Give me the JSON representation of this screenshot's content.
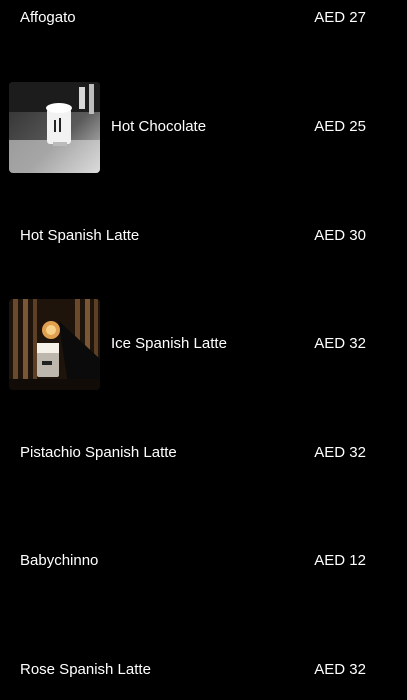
{
  "menu": {
    "currency": "AED",
    "items": [
      {
        "name": "Affogato",
        "price": "AED 27",
        "has_image": false
      },
      {
        "name": "Hot Chocolate",
        "price": "AED 25",
        "has_image": true,
        "image": "hot-chocolate-photo"
      },
      {
        "name": "Hot Spanish Latte",
        "price": "AED 30",
        "has_image": false
      },
      {
        "name": "Ice Spanish Latte",
        "price": "AED 32",
        "has_image": true,
        "image": "ice-spanish-latte-photo"
      },
      {
        "name": "Pistachio Spanish Latte",
        "price": "AED 32",
        "has_image": false
      },
      {
        "name": "Babychinno",
        "price": "AED 12",
        "has_image": false
      },
      {
        "name": "Rose Spanish Latte",
        "price": "AED 32",
        "has_image": false
      }
    ]
  },
  "colors": {
    "background": "#000000",
    "text": "#ffffff"
  }
}
